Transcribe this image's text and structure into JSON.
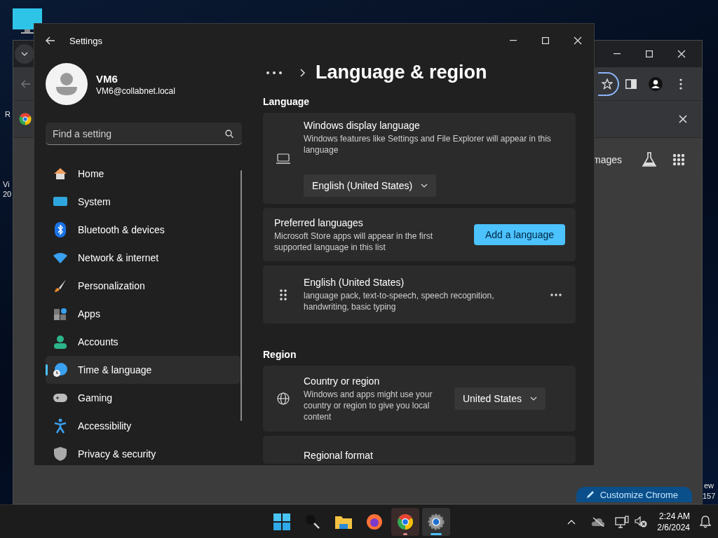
{
  "desktop_text": [
    "R",
    "Vi",
    "20",
    "ew",
    "157"
  ],
  "browser_window": {
    "page_link": "mages",
    "customize_button": "Customize Chrome"
  },
  "settings_window": {
    "title": "Settings",
    "user": {
      "name": "VM6",
      "email": "VM6@collabnet.local"
    },
    "search": {
      "placeholder": "Find a setting"
    },
    "nav": [
      {
        "label": "Home",
        "selected": false
      },
      {
        "label": "System",
        "selected": false
      },
      {
        "label": "Bluetooth & devices",
        "selected": false
      },
      {
        "label": "Network & internet",
        "selected": false
      },
      {
        "label": "Personalization",
        "selected": false
      },
      {
        "label": "Apps",
        "selected": false
      },
      {
        "label": "Accounts",
        "selected": false
      },
      {
        "label": "Time & language",
        "selected": true
      },
      {
        "label": "Gaming",
        "selected": false
      },
      {
        "label": "Accessibility",
        "selected": false
      },
      {
        "label": "Privacy & security",
        "selected": false
      }
    ],
    "page_title": "Language & region",
    "sections": [
      {
        "heading": "Language",
        "cards": [
          {
            "kind": "dropdown",
            "title": "Windows display language",
            "description": "Windows features like Settings and File Explorer will appear in this language",
            "value": "English (United States)"
          },
          {
            "kind": "button",
            "title": "Preferred languages",
            "description": "Microsoft Store apps will appear in the first supported language in this list",
            "button": "Add a language"
          },
          {
            "kind": "item",
            "title": "English (United States)",
            "description": "language pack, text-to-speech, speech recognition, handwriting, basic typing"
          }
        ]
      },
      {
        "heading": "Region",
        "cards": [
          {
            "kind": "inline-dropdown",
            "title": "Country or region",
            "description": "Windows and apps might use your country or region to give you local content",
            "value": "United States"
          },
          {
            "kind": "partial",
            "title": "Regional format"
          }
        ]
      }
    ]
  },
  "taskbar": {
    "apps": [
      {
        "kind": "start",
        "running": false,
        "selected": false
      },
      {
        "kind": "search",
        "running": false,
        "selected": false
      },
      {
        "kind": "explorer",
        "running": false,
        "selected": false
      },
      {
        "kind": "firefox",
        "running": false,
        "selected": false
      },
      {
        "kind": "chrome",
        "running": true,
        "selected": false
      },
      {
        "kind": "settings",
        "running": true,
        "selected": true
      }
    ],
    "time": "2:24 AM",
    "date": "2/6/2024"
  }
}
